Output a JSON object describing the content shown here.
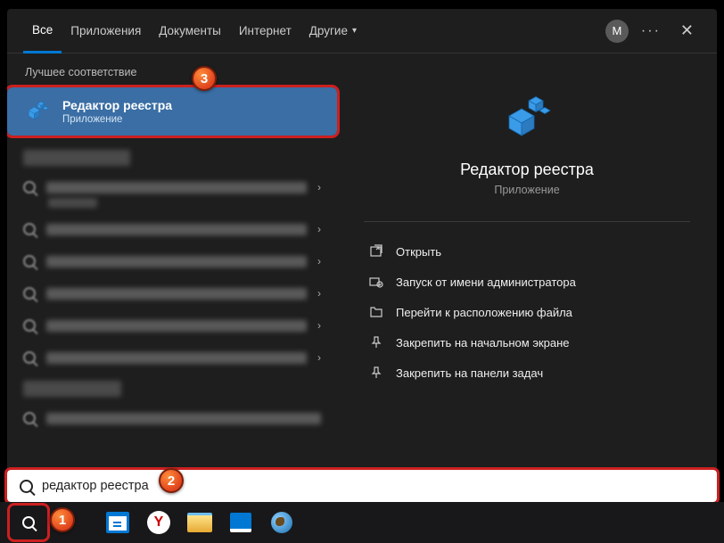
{
  "tabs": {
    "all": "Все",
    "apps": "Приложения",
    "docs": "Документы",
    "web": "Интернет",
    "more": "Другие"
  },
  "avatar_letter": "M",
  "section_best": "Лучшее соответствие",
  "best_match": {
    "title": "Редактор реестра",
    "subtitle": "Приложение"
  },
  "preview": {
    "title": "Редактор реестра",
    "subtitle": "Приложение"
  },
  "actions": {
    "open": "Открыть",
    "admin": "Запуск от имени администратора",
    "location": "Перейти к расположению файла",
    "pin_start": "Закрепить на начальном экране",
    "pin_taskbar": "Закрепить на панели задач"
  },
  "search_query": "редактор реестра",
  "badges": {
    "b1": "1",
    "b2": "2",
    "b3": "3"
  }
}
